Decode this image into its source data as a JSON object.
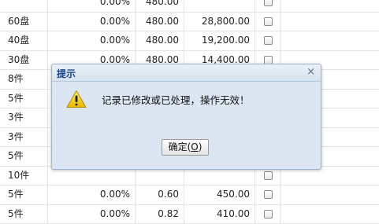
{
  "table": {
    "rows": [
      {
        "unit": "",
        "discount": "0.00%",
        "price": "480.00",
        "amount": "",
        "checked": false
      },
      {
        "unit": "60盘",
        "discount": "0.00%",
        "price": "480.00",
        "amount": "28,800.00",
        "checked": false
      },
      {
        "unit": "40盘",
        "discount": "0.00%",
        "price": "480.00",
        "amount": "19,200.00",
        "checked": false
      },
      {
        "unit": "30盘",
        "discount": "0.00%",
        "price": "480.00",
        "amount": "14,400.00",
        "checked": false
      },
      {
        "unit": "8件",
        "discount": "",
        "price": "",
        "amount": "",
        "checked": false
      },
      {
        "unit": "5件",
        "discount": "",
        "price": "",
        "amount": "",
        "checked": false
      },
      {
        "unit": "3件",
        "discount": "",
        "price": "",
        "amount": "",
        "checked": false
      },
      {
        "unit": "3件",
        "discount": "",
        "price": "",
        "amount": "",
        "checked": false
      },
      {
        "unit": "5件",
        "discount": "",
        "price": "",
        "amount": "",
        "checked": false
      },
      {
        "unit": "10件",
        "discount": "",
        "price": "",
        "amount": "",
        "checked": false
      },
      {
        "unit": "5件",
        "discount": "0.00%",
        "price": "0.60",
        "amount": "450.00",
        "checked": false
      },
      {
        "unit": "5件",
        "discount": "0.00%",
        "price": "0.82",
        "amount": "410.00",
        "checked": false
      }
    ]
  },
  "dialog": {
    "title": "提示",
    "close_glyph": "×",
    "icon": "warning-icon",
    "message": "记录已修改或已处理，操作无效！",
    "ok_label": "确定",
    "ok_shortcut_open": "(",
    "ok_shortcut_key": "O",
    "ok_shortcut_close": ")"
  }
}
